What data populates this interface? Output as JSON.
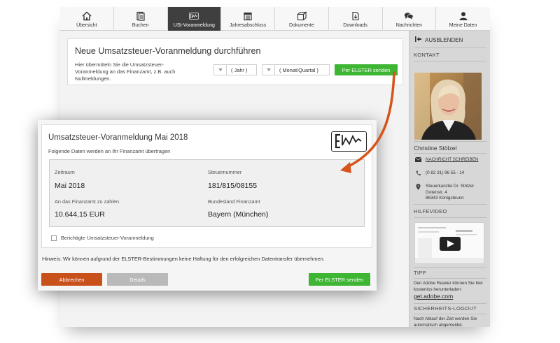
{
  "nav": [
    {
      "label": "Übersicht",
      "icon": "home-icon",
      "active": false
    },
    {
      "label": "Buchen",
      "icon": "document-stack-icon",
      "active": false
    },
    {
      "label": "USt-Voranmeldung",
      "icon": "elster-icon",
      "active": true
    },
    {
      "label": "Jahresabschluss",
      "icon": "calendar-icon",
      "active": false
    },
    {
      "label": "Dokumente",
      "icon": "box-icon",
      "active": false
    },
    {
      "label": "Downloads",
      "icon": "download-icon",
      "active": false
    },
    {
      "label": "Nachrichten",
      "icon": "chat-bubbles-icon",
      "active": false
    },
    {
      "label": "Meine Daten",
      "icon": "user-icon",
      "active": false
    }
  ],
  "main": {
    "title": "Neue Umsatzsteuer-Voranmeldung durchführen",
    "description": "Hier übermitteln Sie die Umsatzsteuer-Voranmeldung an das Finanzamt, z.B. auch Nullmeldungen.",
    "year_select": "( Jahr )",
    "period_select": "( Monat/Quartal )",
    "send_button": "Per ELSTER senden"
  },
  "sidebar": {
    "hide_label": "AUSBLENDEN",
    "contact_heading": "KONTAKT",
    "contact_name": "Christine Stölzel",
    "write_message": "NACHRICHT SCHREIBEN",
    "phone": "(0 82 31) 96 55 - 14",
    "address_line1": "Steuerkanzlei Dr. Stölzel",
    "address_line2": "Gotenstr. 4",
    "address_line3": "86343 Königsbrunn",
    "video_heading": "HILFEVIDEO",
    "tip_heading": "TIPP",
    "tip_text": "Den Adobe Reader können Sie hier kostenlos herunterladen:",
    "tip_link": "get.adobe.com",
    "logout_heading": "SICHERHEITS-LOGOUT",
    "logout_text": "Nach Ablauf der Zeit werden Sie automatisch abgemeldet."
  },
  "dialog": {
    "title": "Umsatzsteuer-Voranmeldung Mai 2018",
    "subtitle": "Folgende Daten werden an Ihr Finanzamt übertragen",
    "period_label": "Zeitraum",
    "period_value": "Mai 2018",
    "taxnum_label": "Steuernummer",
    "taxnum_value": "181/815/08155",
    "amount_label": "An das Finanzamt zu zahlen",
    "amount_value": "10.644,15 EUR",
    "state_label": "Bundesland Finanzamt",
    "state_value": "Bayern (München)",
    "corrected_label": "Berichtigte Umsatzsteuer-Voranmeldung",
    "hint": "Hinweis: Wir können aufgrund der ELSTER-Bestimmungen keine Haftung für den erfolgreichen Datentransfer übernehmen.",
    "cancel_button": "Abbrechen",
    "details_button": "Details",
    "send_button": "Per ELSTER senden"
  },
  "colors": {
    "green": "#3fb534",
    "cancel": "#c8501b",
    "arrow": "#d5541a",
    "nav_active": "#3f3f3f"
  }
}
